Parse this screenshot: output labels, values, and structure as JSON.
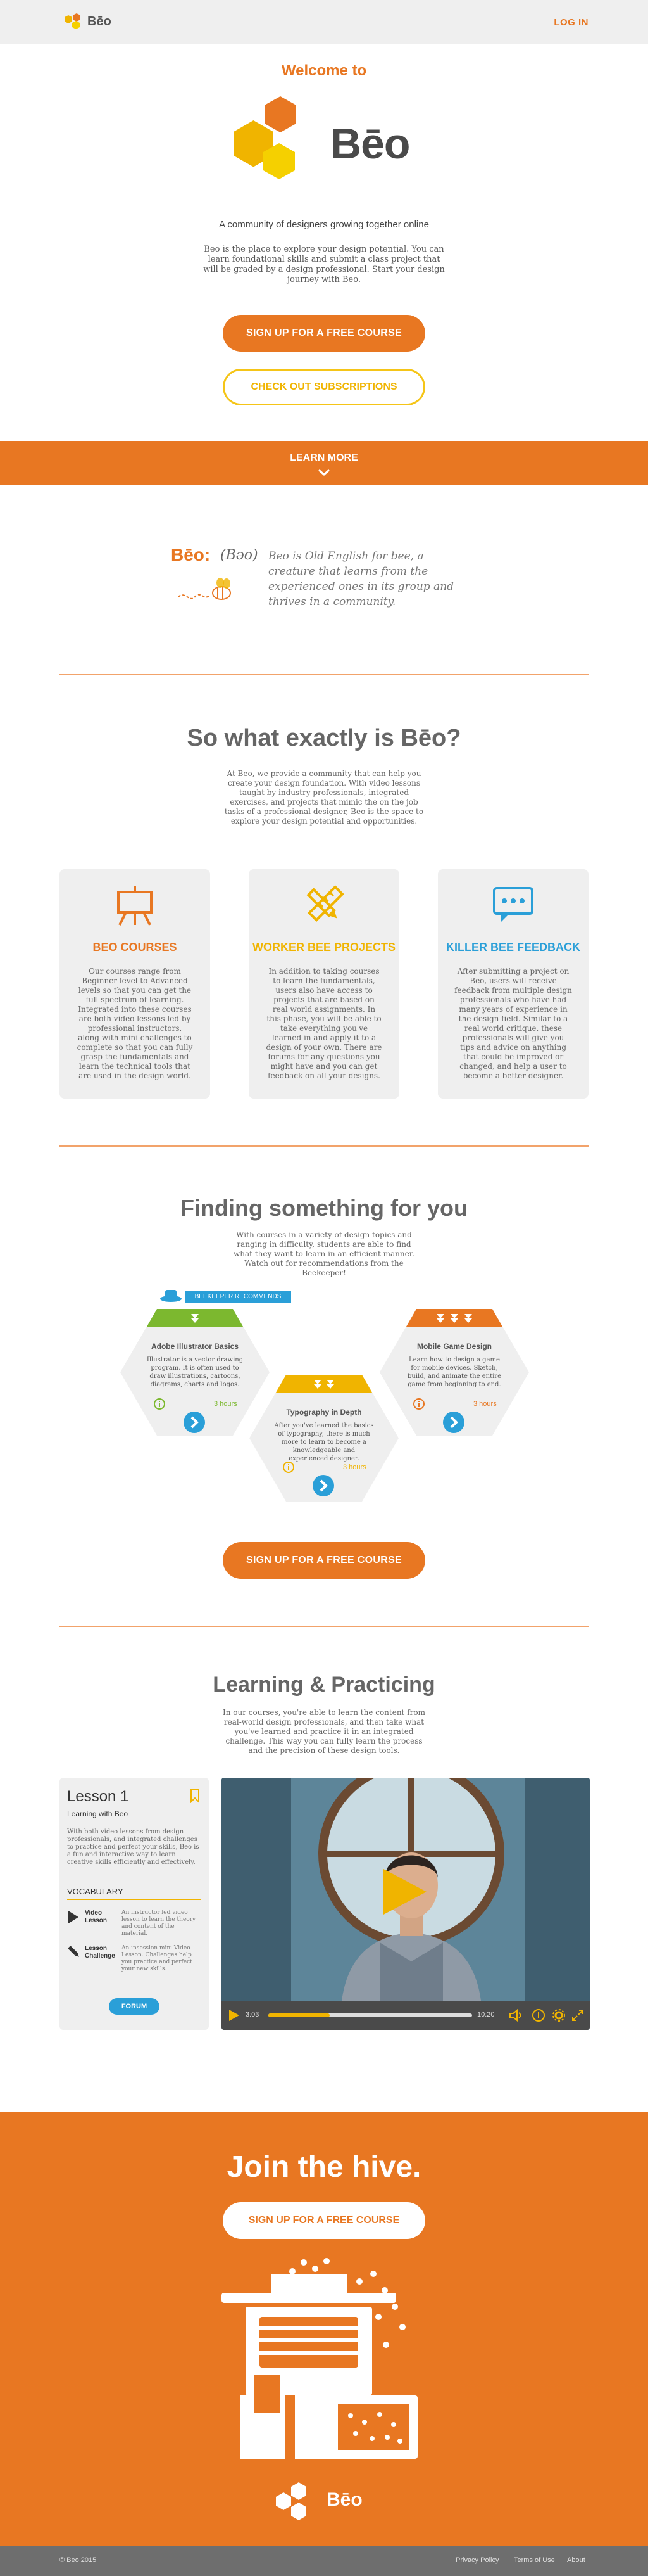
{
  "header": {
    "brand": "Bēo",
    "login": "LOG IN"
  },
  "hero": {
    "welcome": "Welcome to",
    "logo_text": "Bēo",
    "tagline": "A community of designers growing together online",
    "intro": "Beo is the place to explore your design potential. You can learn foundational skills and submit a class project that will be graded by a design professional. Start your design journey with Beo.",
    "cta_primary": "SIGN UP FOR A FREE COURSE",
    "cta_secondary": "CHECK OUT SUBSCRIPTIONS"
  },
  "learn_more": {
    "label": "LEARN MORE"
  },
  "definition": {
    "word": "Bēo:",
    "pronunciation": "(Bəo)",
    "text": "Beo is Old English for bee, a creature that learns from the experienced ones in its group and thrives in a community."
  },
  "what": {
    "heading": "So what exactly is Bēo?",
    "intro": "At Beo, we provide a community that can help you create your design foundation. With video lessons taught by industry professionals, integrated exercises, and projects that mimic the on the job tasks of a professional designer, Beo is the space to explore your design potential and opportunities.",
    "cards": [
      {
        "title": "BEO COURSES",
        "color": "#e87722",
        "icon": "easel-icon",
        "body": "Our courses range from Beginner level to Advanced levels so that you can get the full spectrum of learning. Integrated into these courses are both video lessons led by professional instructors, along with mini challenges to complete so that you can fully grasp the fundamentals and learn the technical tools that are used in the design world."
      },
      {
        "title": "WORKER BEE PROJECTS",
        "color": "#f0b400",
        "icon": "pencil-ruler-icon",
        "body": "In addition to taking courses to learn the fundamentals, users also have access to projects that are based on real world assignments. In this phase, you will be able to take everything you've learned in and apply it to a design of your own. There are forums for any questions you might have and you can get feedback on all your designs."
      },
      {
        "title": "KILLER BEE FEEDBACK",
        "color": "#2a9fd8",
        "icon": "chat-bubble-icon",
        "body": "After submitting a project on Beo, users will receive feedback from multiple design professionals who have had many years of experience in the design field. Similar to a real world critique, these professionals will give you tips and advice on anything that could be improved or changed, and help a user to become a better designer."
      }
    ]
  },
  "finding": {
    "heading": "Finding something for you",
    "intro": "With courses in a variety of design topics and ranging in difficulty, students are able to find what they want to learn in an efficient manner. Watch out for recommendations from the Beekeeper!",
    "badge": "BEEKEEPER RECOMMENDS",
    "courses": [
      {
        "title": "Adobe Illustrator Basics",
        "desc": "Illustrator is a vector drawing program. It is often used to draw illustrations, cartoons, diagrams, charts and logos.",
        "time": "3 hours",
        "color": "#7cb82f"
      },
      {
        "title": "Typography in Depth",
        "desc": "After you've learned the basics of typography, there is much more to learn to become a knowledgeable and experienced designer.",
        "time": "3 hours",
        "color": "#f0b400"
      },
      {
        "title": "Mobile Game Design",
        "desc": "Learn how to design a game for mobile devices. Sketch, build, and animate the entire game from beginning to end.",
        "time": "3 hours",
        "color": "#e87722"
      }
    ],
    "cta": "SIGN UP FOR A FREE COURSE"
  },
  "learning": {
    "heading": "Learning & Practicing",
    "intro": "In our courses, you're able to learn the content from real-world design professionals, and then take what you've learned and practice it in an integrated challenge. This way you can fully learn the process and the precision of these design tools.",
    "lesson": {
      "title": "Lesson 1",
      "subtitle": "Learning with Beo",
      "desc": "With both video lessons from design professionals, and integrated challenges to practice and perfect your skills, Beo is a fun and interactive way to learn creative skills efficiently and effectively.",
      "vocab_label": "VOCABULARY",
      "vocab": [
        {
          "term": "Video Lesson",
          "def": "An instructor led video lesson to learn the theory and content of the material."
        },
        {
          "term": "Lesson Challenge",
          "def": "An insession mini Video Lesson. Challenges help you practice and perfect your new skills."
        }
      ],
      "forum": "FORUM"
    },
    "player": {
      "current": "3:03",
      "total": "10:20",
      "progress": 0.3
    }
  },
  "hive": {
    "heading": "Join the hive.",
    "cta": "SIGN UP FOR A FREE COURSE",
    "logo_text": "Bēo"
  },
  "footer": {
    "copyright": "© Beo 2015",
    "links": [
      "Privacy Policy",
      "Terms of Use",
      "About"
    ]
  }
}
